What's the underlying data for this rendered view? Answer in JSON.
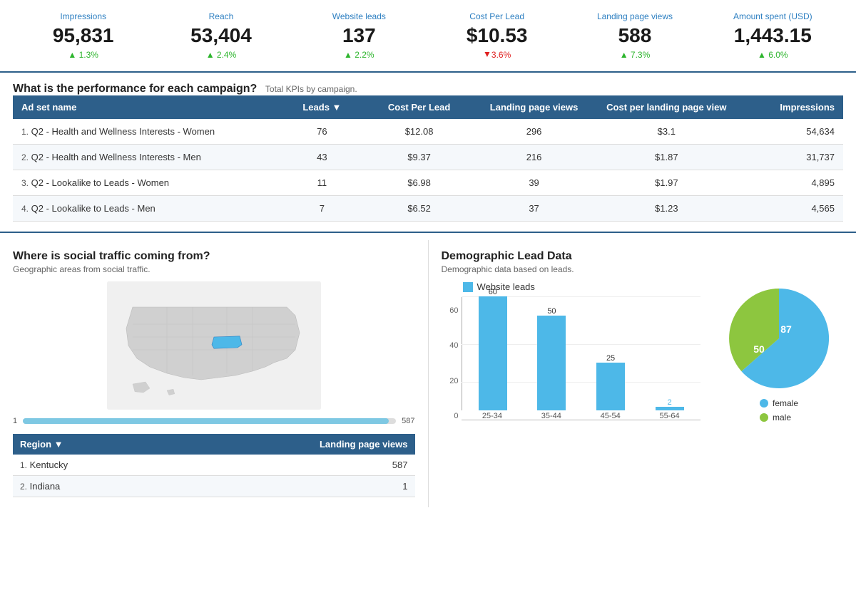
{
  "kpis": [
    {
      "label": "Impressions",
      "value": "95,831",
      "change": "1.3%",
      "direction": "up"
    },
    {
      "label": "Reach",
      "value": "53,404",
      "change": "2.4%",
      "direction": "up"
    },
    {
      "label": "Website leads",
      "value": "137",
      "change": "2.2%",
      "direction": "up"
    },
    {
      "label": "Cost Per Lead",
      "value": "$10.53",
      "change": "3.6%",
      "direction": "down"
    },
    {
      "label": "Landing page views",
      "value": "588",
      "change": "7.3%",
      "direction": "up"
    },
    {
      "label": "Amount spent (USD)",
      "value": "1,443.15",
      "change": "6.0%",
      "direction": "up"
    }
  ],
  "campaign_table": {
    "title": "What is the performance for each campaign?",
    "subtitle": "Total KPIs by campaign.",
    "columns": [
      "Ad set name",
      "Leads",
      "Cost Per Lead",
      "Landing page views",
      "Cost per landing page view",
      "Impressions"
    ],
    "rows": [
      {
        "num": "1.",
        "name": "Q2 - Health and Wellness Interests - Women",
        "leads": "76",
        "cpl": "$12.08",
        "lpv": "296",
        "cpv": "$3.1",
        "impressions": "54,634"
      },
      {
        "num": "2.",
        "name": "Q2 - Health and Wellness Interests - Men",
        "leads": "43",
        "cpl": "$9.37",
        "lpv": "216",
        "cpv": "$1.87",
        "impressions": "31,737"
      },
      {
        "num": "3.",
        "name": "Q2 - Lookalike to Leads - Women",
        "leads": "11",
        "cpl": "$6.98",
        "lpv": "39",
        "cpv": "$1.97",
        "impressions": "4,895"
      },
      {
        "num": "4.",
        "name": "Q2 - Lookalike to Leads - Men",
        "leads": "7",
        "cpl": "$6.52",
        "lpv": "37",
        "cpv": "$1.23",
        "impressions": "4,565"
      }
    ]
  },
  "social_traffic": {
    "title": "Where is social traffic coming from?",
    "subtitle": "Geographic areas from social traffic.",
    "slider_min": "1",
    "slider_max": "587",
    "region_columns": [
      "Region",
      "Landing page views"
    ],
    "regions": [
      {
        "num": "1.",
        "name": "Kentucky",
        "lpv": "587"
      },
      {
        "num": "2.",
        "name": "Indiana",
        "lpv": "1"
      }
    ]
  },
  "demographic": {
    "title": "Demographic Lead Data",
    "subtitle": "Demographic data based on leads.",
    "legend_website_leads": "Website leads",
    "bars": [
      {
        "age": "25-34",
        "value": 60,
        "label": "60"
      },
      {
        "age": "35-44",
        "value": 50,
        "label": "50"
      },
      {
        "age": "45-54",
        "value": 25,
        "label": "25"
      },
      {
        "age": "55-64",
        "value": 2,
        "label": "2"
      }
    ],
    "y_labels": [
      "0",
      "20",
      "40",
      "60"
    ],
    "pie": {
      "female_value": 87,
      "male_value": 50,
      "female_color": "#4db8e8",
      "male_color": "#8dc63f",
      "female_label": "female",
      "male_label": "male"
    }
  }
}
